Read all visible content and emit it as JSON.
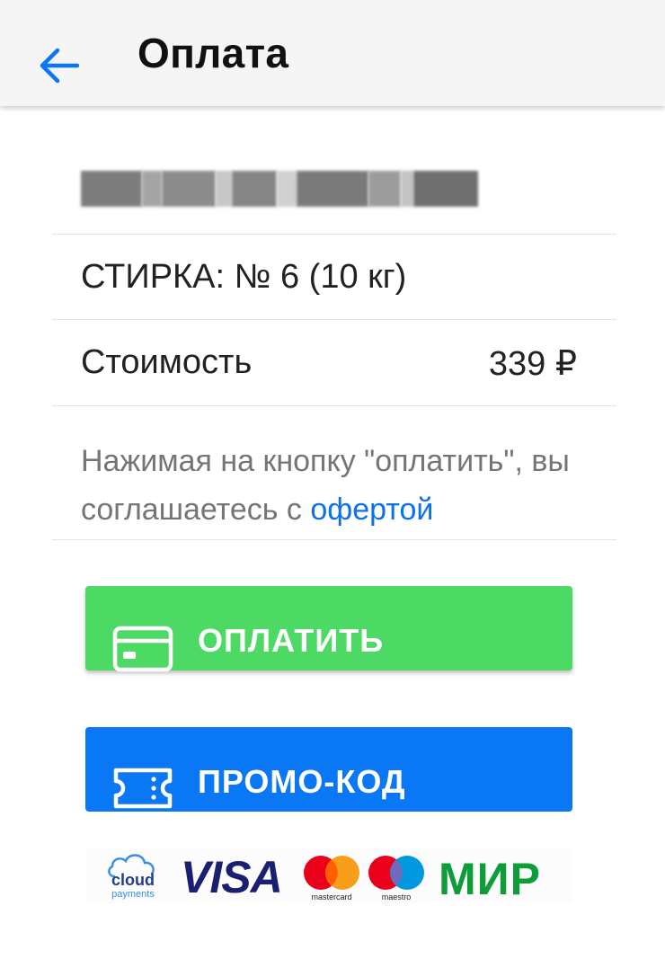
{
  "header": {
    "title": "Оплата",
    "back_icon": "arrow-left-icon"
  },
  "order": {
    "address_redacted": true,
    "service": "СТИРКА: № 6 (10 кг)",
    "price_label": "Стоимость",
    "price_value": "339 ₽"
  },
  "terms": {
    "text": "Нажимая на кнопку \"оплатить\", вы соглашаетесь с ",
    "link_label": "офертой"
  },
  "buttons": {
    "pay_label": "ОПЛАТИТЬ",
    "pay_icon": "credit-card-icon",
    "promo_label": "ПРОМО-КОД",
    "promo_icon": "ticket-icon"
  },
  "payment_logos": {
    "cloud_top": "cloud",
    "cloud_bottom": "payments",
    "visa": "VISA",
    "mastercard_caption": "mastercard",
    "maestro_caption": "maestro",
    "mir": "МИР"
  },
  "colors": {
    "accent_blue": "#0a77f5",
    "pay_green": "#4cd964",
    "link_blue": "#0d72e8",
    "appbar_bg": "#f5f5f5"
  }
}
